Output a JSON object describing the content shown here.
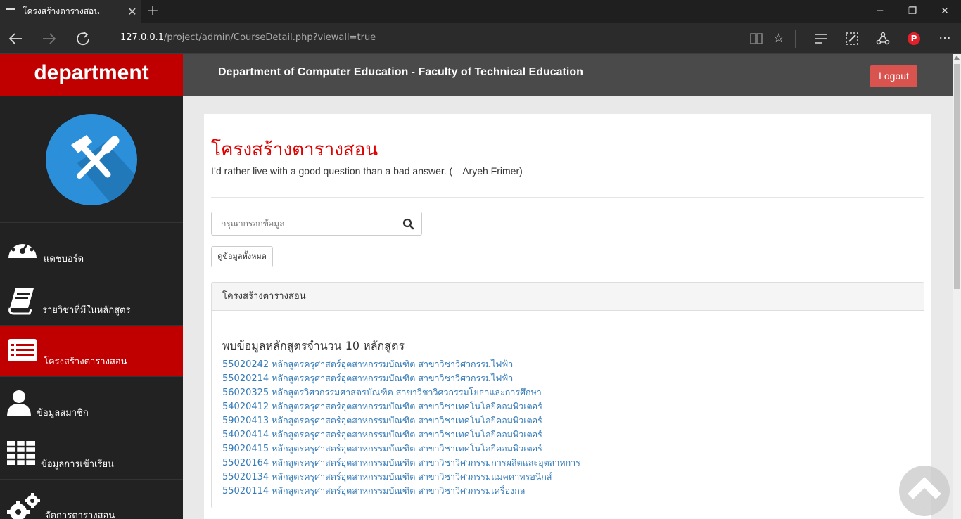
{
  "browser": {
    "tab_title": "โครงสร้างตารางสอน",
    "url_host": "127.0.0.1",
    "url_path": "/project/admin/CourseDetail.php?viewall=true",
    "icons": [
      "back-icon",
      "forward-icon",
      "refresh-icon",
      "reading-view-icon",
      "favorite-star-icon",
      "hub-icon",
      "web-note-icon",
      "share-icon",
      "pinterest-icon",
      "more-icon"
    ]
  },
  "sidebar": {
    "brand": "department",
    "items": [
      {
        "label": "แดชบอร์ด",
        "icon": "dashboard-icon"
      },
      {
        "label": "รายวิชาที่มีในหลักสูตร",
        "icon": "book-icon"
      },
      {
        "label": "โครงสร้างตารางสอน",
        "icon": "list-icon",
        "active": true
      },
      {
        "label": "ข้อมูลสมาชิก",
        "icon": "user-icon"
      },
      {
        "label": "ข้อมูลการเข้าเรียน",
        "icon": "table-icon"
      },
      {
        "label": "จัดการตารางสอน",
        "icon": "gears-icon"
      }
    ]
  },
  "header": {
    "title": "Department of Computer Education - Faculty of Technical Education",
    "logout_label": "Logout"
  },
  "main": {
    "title": "โครงสร้างตารางสอน",
    "quote": "I’d rather live with a good question than a bad answer. (—Aryeh Frimer)",
    "search_placeholder": "กรุณากรอกข้อมูล",
    "show_all_label": "ดูข้อมูลทั้งหมด",
    "panel_title": "โครงสร้างตารางสอน",
    "result_text": "พบข้อมูลหลักสูตรจำนวน 10 หลักสูตร",
    "courses": [
      {
        "code": "55020242",
        "name": "หลักสูตรครุศาสตร์อุตสาหกรรมบัณฑิต สาขาวิชาวิศวกรรมไฟฟ้า"
      },
      {
        "code": "55020214",
        "name": "หลักสูตรครุศาสตร์อุตสาหกรรมบัณฑิต สาขาวิชาวิศวกรรมไฟฟ้า"
      },
      {
        "code": "56020325",
        "name": "หลักสูตรวิศวกรรมศาสตรบัณฑิต สาขาวิชาวิศวกรรมโยธาและการศึกษา"
      },
      {
        "code": "54020412",
        "name": "หลักสูตรครุศาสตร์อุตสาหกรรมบัณฑิต สาขาวิชาเทคโนโลยีคอมพิวเตอร์"
      },
      {
        "code": "59020413",
        "name": "หลักสูตรครุศาสตร์อุตสาหกรรมบัณฑิต สาขาวิชาเทคโนโลยีคอมพิวเตอร์"
      },
      {
        "code": "54020414",
        "name": "หลักสูตรครุศาสตร์อุตสาหกรรมบัณฑิต สาขาวิชาเทคโนโลยีคอมพิวเตอร์"
      },
      {
        "code": "59020415",
        "name": "หลักสูตรครุศาสตร์อุตสาหกรรมบัณฑิต สาขาวิชาเทคโนโลยีคอมพิวเตอร์"
      },
      {
        "code": "55020164",
        "name": "หลักสูตรครุศาสตร์อุตสาหกรรมบัณฑิต สาขาวิชาวิศวกรรมการผลิตและอุตสาหการ"
      },
      {
        "code": "55020134",
        "name": "หลักสูตรครุศาสตร์อุตสาหกรรมบัณฑิต สาขาวิชาวิศวกรรมแมคคาทรอนิกส์"
      },
      {
        "code": "55020114",
        "name": "หลักสูตรครุศาสตร์อุตสาหกรรมบัณฑิต สาขาวิชาวิศวกรรมเครื่องกล"
      }
    ]
  },
  "colors": {
    "brand_red": "#c00000",
    "title_red": "#e00000",
    "link_blue": "#337ab7",
    "logout_red": "#d9534f",
    "logo_blue": "#2b8fd9"
  }
}
